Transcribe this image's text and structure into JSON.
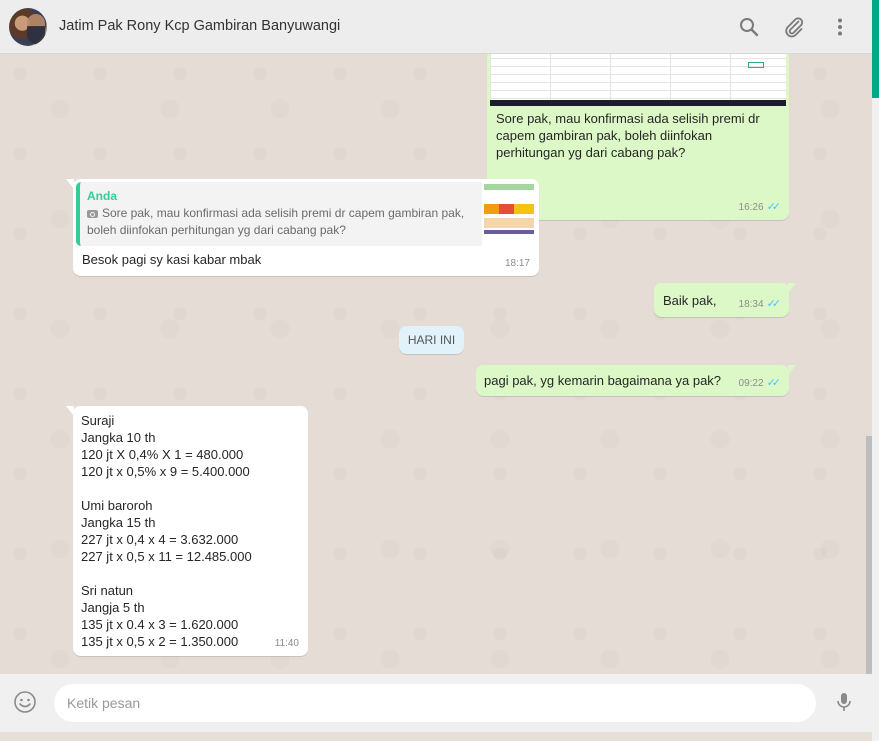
{
  "header": {
    "title": "Jatim Pak Rony Kcp Gambiran Banyuwangi",
    "icons": [
      "search-icon",
      "attach-icon",
      "menu-icon"
    ]
  },
  "messages": {
    "image_caption": {
      "text": "Sore pak, mau konfirmasi ada selisih premi dr capem gambiran pak, boleh diinfokan perhitungan yg dari cabang pak?",
      "time": "16:26",
      "ticks": "✓✓"
    },
    "reply": {
      "quoted_author": "Anda",
      "quoted_text": "Sore pak, mau konfirmasi ada selisih premi dr capem gambiran pak, boleh diinfokan perhitungan yg dari cabang pak?",
      "text": "Besok pagi sy kasi kabar mbak",
      "time": "18:17"
    },
    "baik": {
      "text": "Baik pak,",
      "time": "18:34",
      "ticks": "✓✓"
    },
    "date_divider": "HARI INI",
    "pagi": {
      "text": "pagi pak, yg kemarin bagaimana ya pak?",
      "time": "09:22",
      "ticks": "✓✓"
    },
    "calc": {
      "lines": [
        "Suraji",
        "Jangka 10 th",
        "120 jt X 0,4% X 1 = 480.000",
        "120 jt x 0,5% x 9 = 5.400.000",
        "",
        "Umi baroroh",
        "Jangka 15 th",
        "227 jt x 0,4 x 4 = 3.632.000",
        "227 jt x 0,5 x 11 = 12.485.000",
        "",
        "Sri natun",
        "Jangja 5 th",
        "135 jt x 0.4 x 3 = 1.620.000",
        "135 jt x 0,5 x 2 = 1.350.000"
      ],
      "time": "11:40"
    }
  },
  "composer": {
    "placeholder": "Ketik pesan",
    "icons": [
      "emoji-icon",
      "mic-icon"
    ]
  },
  "colors": {
    "outgoing_bubble": "#dcf8c6",
    "incoming_bubble": "#ffffff",
    "read_ticks": "#4fc3f7",
    "quote_accent": "#35cd96",
    "date_chip": "#e1f2fb"
  }
}
